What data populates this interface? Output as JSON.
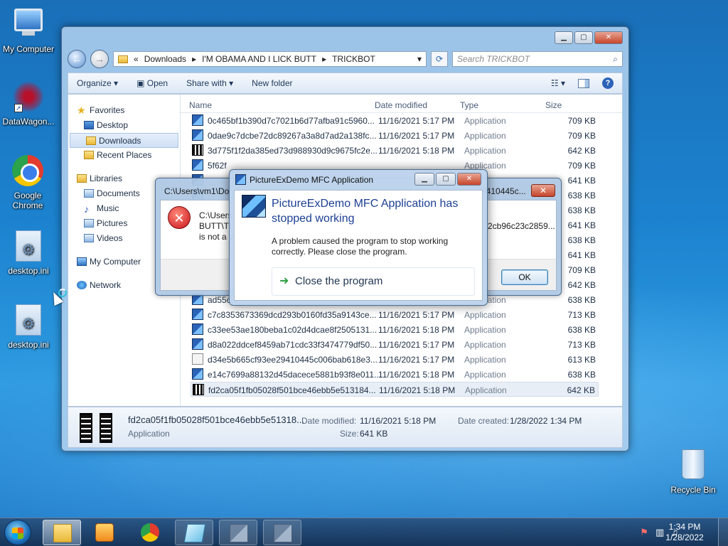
{
  "desktop": {
    "icons": [
      {
        "label": "My Computer",
        "icon": "computer-icon"
      },
      {
        "label": "DataWagon...",
        "icon": "datawagon-icon"
      },
      {
        "label": "Google Chrome",
        "icon": "chrome-icon"
      },
      {
        "label": "desktop.ini",
        "icon": "ini-file-icon"
      },
      {
        "label": "desktop.ini",
        "icon": "ini-file-icon"
      },
      {
        "label": "Recycle Bin",
        "icon": "recycle-bin-icon"
      }
    ]
  },
  "explorer": {
    "address": {
      "chevron": "«",
      "crumbs": [
        "Downloads",
        "I'M OBAMA AND I LICK BUTT",
        "TRICKBOT"
      ],
      "sep": "▸"
    },
    "search_placeholder": "Search TRICKBOT",
    "toolbar": {
      "organize": "Organize ▾",
      "open": "Open",
      "share": "Share with ▾",
      "new_folder": "New folder"
    },
    "nav": {
      "favorites": "Favorites",
      "desktop": "Desktop",
      "downloads": "Downloads",
      "recent": "Recent Places",
      "libraries": "Libraries",
      "documents": "Documents",
      "music": "Music",
      "pictures": "Pictures",
      "videos": "Videos",
      "computer": "My Computer",
      "network": "Network"
    },
    "columns": {
      "name": "Name",
      "date": "Date modified",
      "type": "Type",
      "size": "Size"
    },
    "files": [
      {
        "name": "0c465bf1b390d7c7021b6d77afba91c5960...",
        "date": "11/16/2021 5:17 PM",
        "type": "Application",
        "size": "709 KB",
        "icon": "a"
      },
      {
        "name": "0dae9c7dcbe72dc89267a3a8d7ad2a138fc...",
        "date": "11/16/2021 5:17 PM",
        "type": "Application",
        "size": "709 KB",
        "icon": "a"
      },
      {
        "name": "3d775f1f2da385ed73d988930d9c9675fc2e...",
        "date": "11/16/2021 5:18 PM",
        "type": "Application",
        "size": "642 KB",
        "icon": "b"
      },
      {
        "name": "5f62f",
        "date": "",
        "type": "Application",
        "size": "709 KB",
        "icon": "a"
      },
      {
        "name": "",
        "date": "",
        "type": "",
        "size": "641 KB",
        "icon": "a"
      },
      {
        "name": "",
        "date": "",
        "type": "",
        "size": "638 KB",
        "icon": "a"
      },
      {
        "name": "",
        "date": "",
        "type": "",
        "size": "638 KB",
        "icon": "a"
      },
      {
        "name": "",
        "date": "",
        "type": "",
        "size": "641 KB",
        "icon": "b"
      },
      {
        "name": "",
        "date": "",
        "type": "",
        "size": "638 KB",
        "icon": "a"
      },
      {
        "name": "",
        "date": "",
        "type": "",
        "size": "641 KB",
        "icon": "b"
      },
      {
        "name": "",
        "date": "",
        "type": "",
        "size": "709 KB",
        "icon": "a"
      },
      {
        "name": "",
        "date": "",
        "type": "",
        "size": "642 KB",
        "icon": "b"
      },
      {
        "name": "ad55c",
        "date": "",
        "type": "Application",
        "size": "638 KB",
        "icon": "a"
      },
      {
        "name": "c7c8353673369dcd293b0160fd35a9143ce...",
        "date": "11/16/2021 5:17 PM",
        "type": "Application",
        "size": "713 KB",
        "icon": "a"
      },
      {
        "name": "c33ee53ae180beba1c02d4dcae8f2505131...",
        "date": "11/16/2021 5:18 PM",
        "type": "Application",
        "size": "638 KB",
        "icon": "a"
      },
      {
        "name": "d8a022ddcef8459ab71cdc33f3474779df50...",
        "date": "11/16/2021 5:17 PM",
        "type": "Application",
        "size": "713 KB",
        "icon": "a"
      },
      {
        "name": "d34e5b665cf93ee29410445c006bab618e3...",
        "date": "11/16/2021 5:17 PM",
        "type": "Application",
        "size": "613 KB",
        "icon": "c"
      },
      {
        "name": "e14c7699a88132d45dacece5881b93f8e011...",
        "date": "11/16/2021 5:18 PM",
        "type": "Application",
        "size": "638 KB",
        "icon": "a"
      },
      {
        "name": "fd2ca05f1fb05028f501bce46ebb5e513184...",
        "date": "11/16/2021 5:18 PM",
        "type": "Application",
        "size": "642 KB",
        "icon": "b"
      }
    ],
    "details": {
      "name": "fd2ca05f1fb05028f501bce46ebb5e51318...",
      "type": "Application",
      "modified_label": "Date modified:",
      "modified": "11/16/2021 5:18 PM",
      "size_label": "Size:",
      "size": "641 KB",
      "created_label": "Date created:",
      "created": "1/28/2022 1:34 PM"
    }
  },
  "error_dialog": {
    "title": "C:\\Users\\vm1\\Do",
    "title_right": "9410445c...",
    "line1": "C:\\Users",
    "line2": "BUTT\\TI",
    "line3": "is not a v",
    "right_text": "2cb96c23c2859...",
    "ok": "OK"
  },
  "crash_dialog": {
    "title": "PictureExDemo MFC Application",
    "heading": "PictureExDemo MFC Application has stopped working",
    "message": "A problem caused the program to stop working correctly. Please close the program.",
    "close_program": "Close the program"
  },
  "taskbar": {
    "time": "1:34 PM",
    "date": "1/28/2022"
  }
}
